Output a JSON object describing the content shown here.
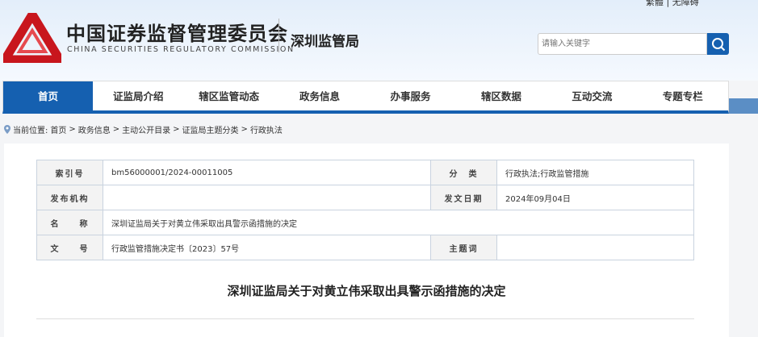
{
  "header": {
    "top_links": "繁體 | 无障碍",
    "org_cn": "中国证券监督管理委员会",
    "org_en": "CHINA SECURITIES REGULATORY COMMISSION",
    "sub_org": "深圳监管局",
    "search_placeholder": "请输入关键字"
  },
  "nav": [
    "首页",
    "证监局介绍",
    "辖区监管动态",
    "政务信息",
    "办事服务",
    "辖区数据",
    "互动交流",
    "专题专栏"
  ],
  "breadcrumb": {
    "prefix": "当前位置:",
    "items": [
      "首页",
      "政务信息",
      "主动公开目录",
      "证监局主题分类",
      "行政执法"
    ]
  },
  "info": {
    "index_label": "索引号",
    "index_value": "bm56000001/2024-00011005",
    "category_label": "分　类",
    "category_value": "行政执法;行政监管措施",
    "publisher_label": "发布机构",
    "publisher_value": "",
    "date_label": "发文日期",
    "date_value": "2024年09月04日",
    "name_label": "名　　称",
    "name_value": "深圳证监局关于对黄立伟采取出具警示函措施的决定",
    "docno_label": "文　　号",
    "docno_value": "行政监管措施决定书〔2023〕57号",
    "keyword_label": "主题词",
    "keyword_value": ""
  },
  "document_title": "深圳证监局关于对黄立伟采取出具警示函措施的决定"
}
